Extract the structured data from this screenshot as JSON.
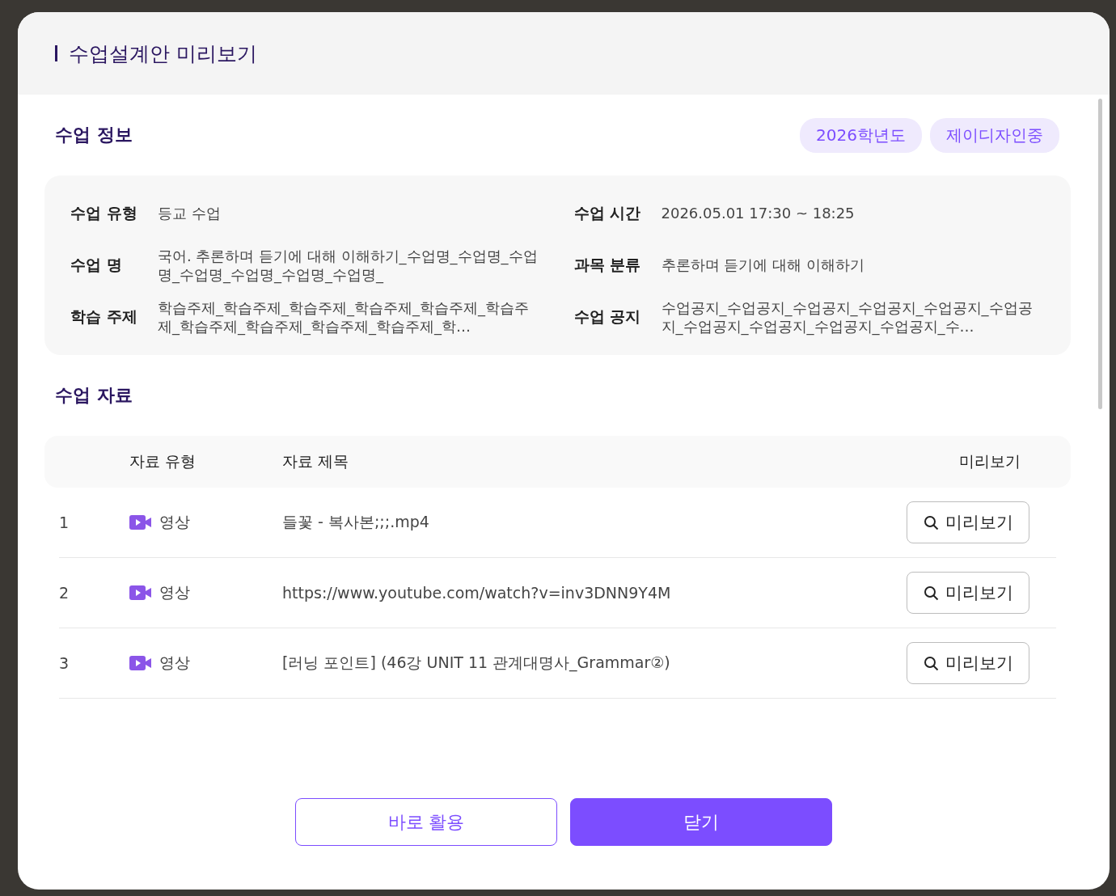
{
  "modal": {
    "title": "수업설계안 미리보기"
  },
  "lesson_info": {
    "heading": "수업 정보",
    "badges": [
      "2026학년도",
      "제이디자인중"
    ],
    "fields": [
      {
        "label": "수업 유형",
        "value": "등교 수업"
      },
      {
        "label": "수업 시간",
        "value": "2026.05.01 17:30 ~ 18:25"
      },
      {
        "label": "수업 명",
        "value": "국어. 추론하며 듣기에 대해 이해하기_수업명_수업명_수업명_수업명_수업명_수업명_수업명_"
      },
      {
        "label": "과목 분류",
        "value": "추론하며 듣기에 대해 이해하기"
      },
      {
        "label": "학습 주제",
        "value": "학습주제_학습주제_학습주제_학습주제_학습주제_학습주제_학습주제_학습주제_학습주제_학습주제_학…"
      },
      {
        "label": "수업 공지",
        "value": "수업공지_수업공지_수업공지_수업공지_수업공지_수업공지_수업공지_수업공지_수업공지_수업공지_수…"
      }
    ]
  },
  "materials": {
    "heading": "수업 자료",
    "columns": [
      "자료 유형",
      "자료 제목",
      "미리보기"
    ],
    "rows": [
      {
        "number": "1",
        "kind": "video",
        "type": "영상",
        "title": "들꽃 - 복사본;;;.mp4",
        "action": "미리보기"
      },
      {
        "number": "2",
        "kind": "video",
        "type": "영상",
        "title": "https://www.youtube.com/watch?v=inv3DNN9Y4M",
        "action": "미리보기"
      },
      {
        "number": "3",
        "kind": "video",
        "type": "영상",
        "title": "[러닝 포인트] (46강 UNIT 11 관계대명사_Grammar②)",
        "action": "미리보기"
      }
    ]
  },
  "footer": {
    "buttons": [
      {
        "label": "바로 활용",
        "kind": "secondary"
      },
      {
        "label": "닫기",
        "kind": "primary"
      }
    ]
  }
}
